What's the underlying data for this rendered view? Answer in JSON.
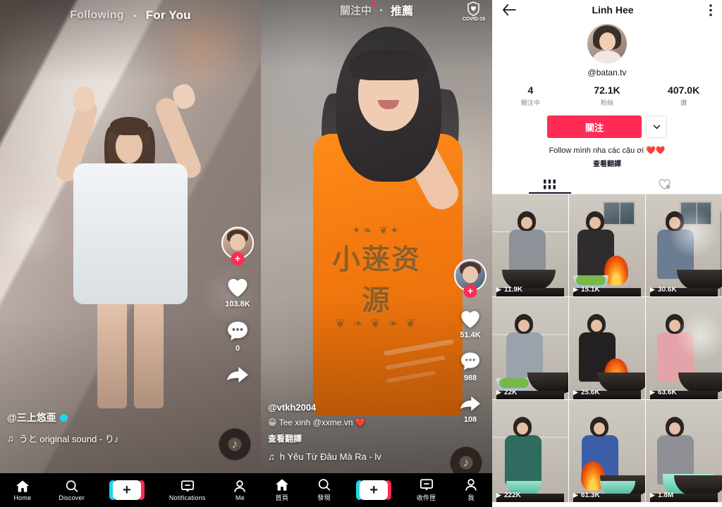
{
  "panel1": {
    "tabs": [
      {
        "label": "Following",
        "active": false
      },
      {
        "label": "For You",
        "active": true
      }
    ],
    "actions": {
      "avatar_badge": "+",
      "like_count": "103.8K",
      "comment_count": "0",
      "share_count": ""
    },
    "caption": {
      "username": "@三上悠亜",
      "verified": true,
      "music_note": "♫",
      "music_text": "うと    original sound - り♪"
    },
    "bottom_nav": [
      {
        "label": "Home",
        "icon": "home-icon"
      },
      {
        "label": "Discover",
        "icon": "search-icon"
      },
      {
        "label": "",
        "icon": "add-icon"
      },
      {
        "label": "Notifications",
        "icon": "inbox-icon"
      },
      {
        "label": "Me",
        "icon": "person-icon"
      }
    ]
  },
  "panel2": {
    "tabs": [
      {
        "label": "關注中",
        "active": false,
        "dot": true
      },
      {
        "label": "推薦",
        "active": true,
        "dot": false
      }
    ],
    "covid_label": "COVID-19",
    "actions": {
      "avatar_badge": "+",
      "like_count": "51.4K",
      "comment_count": "988",
      "share_count": "108"
    },
    "caption": {
      "username": "@vtkh2004",
      "description": "😀 Tee xinh @xxme.vn ❤️",
      "translate": "查看翻譯",
      "music_note": "♫",
      "music_text": "h    Yêu Từ Đâu Mà Ra - lv"
    },
    "watermark": {
      "top_flourish": "✦❧ ❦✦",
      "text": "小蒾资源",
      "bottom_flourish": "❦ ❧ ❦ ❧ ❦"
    },
    "bottom_nav": [
      {
        "label": "首頁",
        "icon": "home-icon"
      },
      {
        "label": "發現",
        "icon": "search-icon"
      },
      {
        "label": "",
        "icon": "add-icon"
      },
      {
        "label": "收件匣",
        "icon": "inbox-icon"
      },
      {
        "label": "我",
        "icon": "person-icon"
      }
    ]
  },
  "panel3": {
    "header": {
      "back_icon": "back-arrow-icon",
      "title": "Linh Hee",
      "menu_icon": "more-vertical-icon"
    },
    "profile": {
      "handle": "@batan.tv",
      "stats": [
        {
          "value": "4",
          "label": "關注中"
        },
        {
          "value": "72.1K",
          "label": "粉絲"
        },
        {
          "value": "407.0K",
          "label": "讚"
        }
      ],
      "follow_label": "關注",
      "dropdown_icon": "chevron-down-icon",
      "bio": "Follow mình nha các cậu ơi ❤️❤️",
      "bio_translate": "查看翻譯"
    },
    "tabs": [
      {
        "icon": "grid-icon",
        "active": true
      },
      {
        "icon": "heart-outline-icon",
        "active": false
      }
    ],
    "videos": [
      {
        "views": "11.9K",
        "scene": "wok"
      },
      {
        "views": "15.1K",
        "scene": "fire"
      },
      {
        "views": "30.6K",
        "scene": "steam"
      },
      {
        "views": "22K",
        "scene": "bowl"
      },
      {
        "views": "25.6K",
        "scene": "fire"
      },
      {
        "views": "63.6K",
        "scene": "steam"
      },
      {
        "views": "222K",
        "scene": "bowl"
      },
      {
        "views": "61.3K",
        "scene": "fire"
      },
      {
        "views": "1.8M",
        "scene": "wok"
      }
    ]
  },
  "colors": {
    "accent_red": "#fe2c55",
    "accent_cyan": "#20d5ec",
    "text_dark": "#161722",
    "text_muted": "#86878b"
  }
}
